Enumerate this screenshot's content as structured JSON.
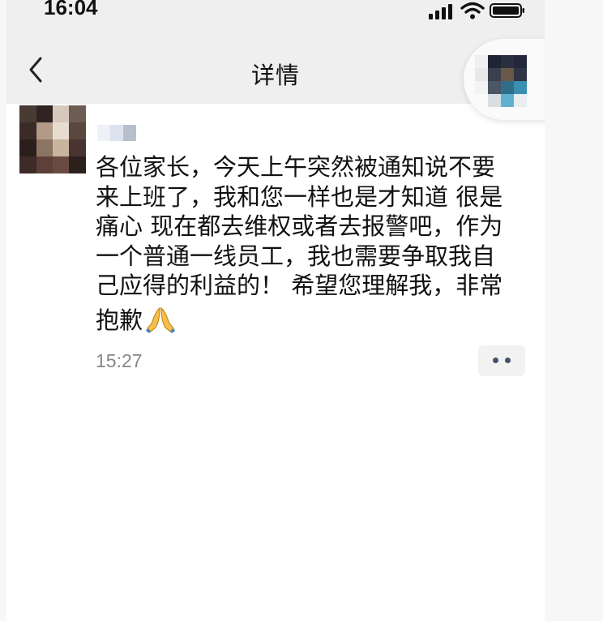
{
  "status_bar": {
    "time": "16:04",
    "icons": [
      "cellular-signal-icon",
      "wifi-icon",
      "battery-icon"
    ]
  },
  "nav": {
    "title": "详情",
    "back_icon": "chevron-left-icon"
  },
  "post": {
    "message_lines": [
      "各位家长，今天上午突然被通知说不要",
      "来上班了，我和您一样也是才知道 很是",
      "痛心 现在都去维权或者去报警吧，作为",
      "一个普通一线员工，我也需要争取我自",
      "己应得的利益的！ 希望您理解我，非常",
      "抱歉"
    ],
    "emoji": "folded-hands",
    "timestamp": "15:27",
    "more_icon": "more-dots-icon"
  },
  "colors": {
    "bar_background": "#efefef",
    "text_primary": "#111111",
    "timestamp": "#888888",
    "more_button_bg": "#f2f2f2",
    "more_dots": "#44506a"
  }
}
